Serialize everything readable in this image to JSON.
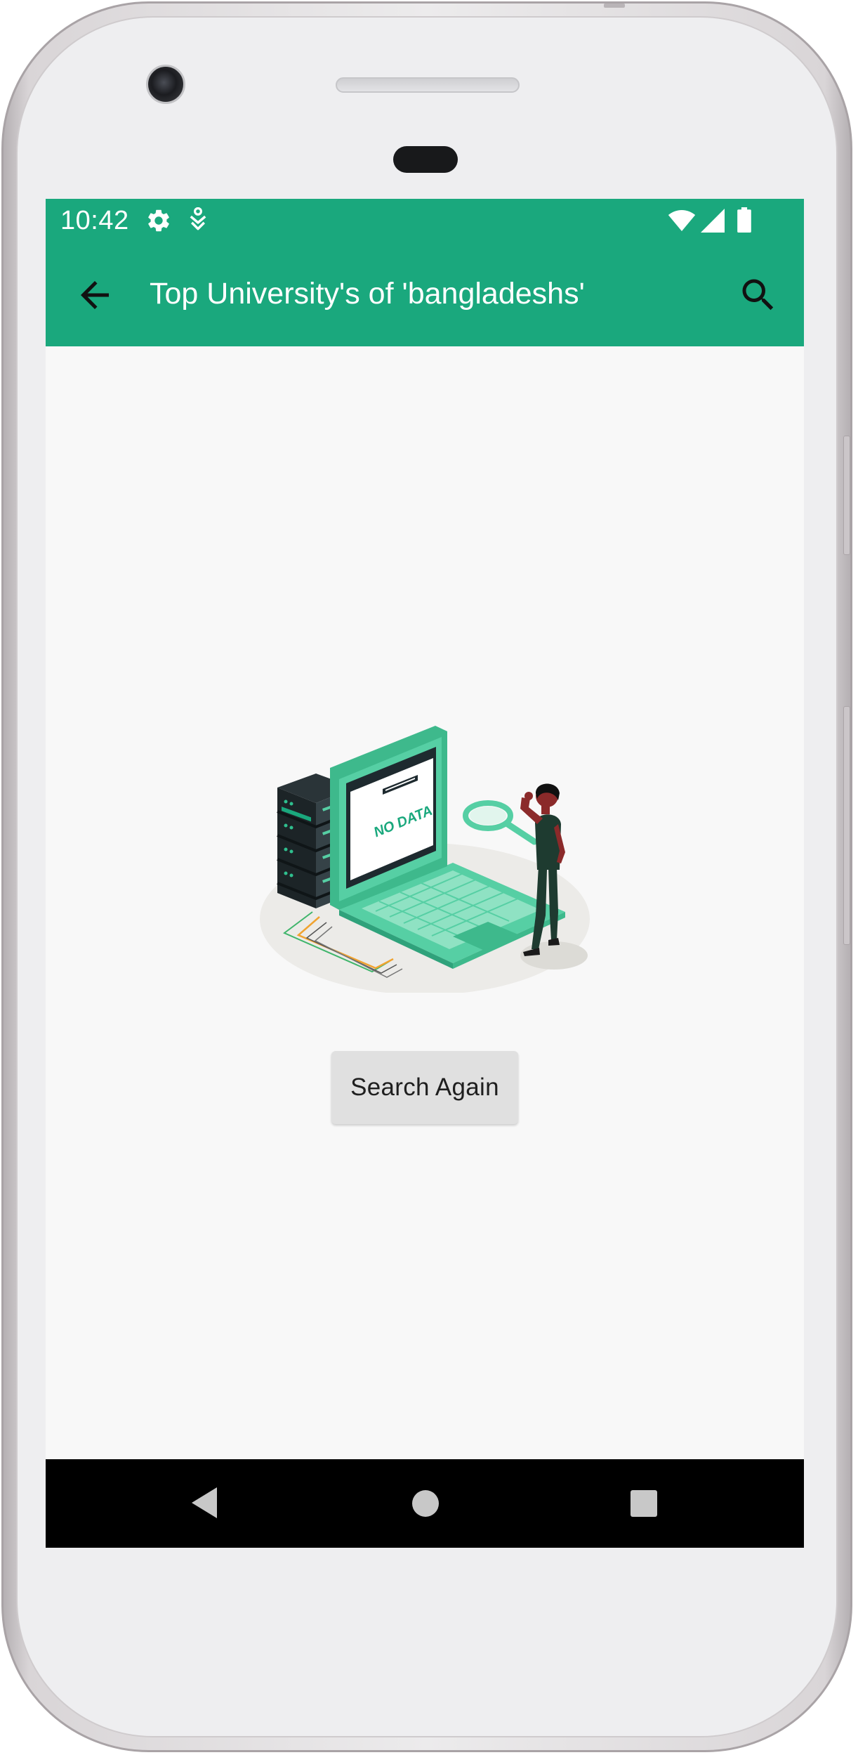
{
  "status_bar": {
    "time": "10:42",
    "left_icons": [
      "settings-gear-icon",
      "accessibility-icon"
    ],
    "right_icons": [
      "wifi-icon",
      "cell-signal-icon",
      "battery-icon"
    ]
  },
  "app_bar": {
    "title": "Top University's of 'bangladeshs'",
    "back_icon": "arrow-back-icon",
    "search_icon": "search-icon",
    "background_color": "#1aa87d"
  },
  "empty_state": {
    "illustration_text": "NO DATA",
    "button_label": "Search Again"
  },
  "nav_bar": {
    "buttons": [
      "nav-back-icon",
      "nav-home-icon",
      "nav-recents-icon"
    ]
  },
  "colors": {
    "accent": "#1aa87d",
    "screen_background": "#f8f8f8",
    "button_background": "#e0e0e0"
  }
}
